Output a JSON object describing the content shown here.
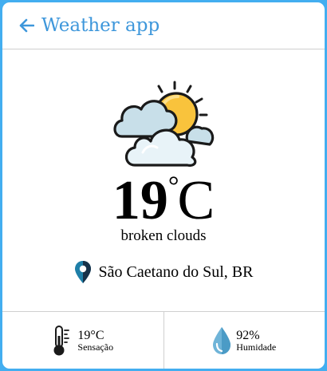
{
  "header": {
    "back_icon": "arrow-left-icon",
    "title": "Weather app"
  },
  "weather": {
    "icon": "broken-clouds-sun-icon",
    "temperature": "19",
    "degree_symbol": "°",
    "unit": "C",
    "description": "broken clouds"
  },
  "location": {
    "icon": "map-pin-icon",
    "text": "São Caetano do Sul, BR"
  },
  "details": {
    "feels_like": {
      "icon": "thermometer-icon",
      "value": "19°C",
      "label": "Sensação"
    },
    "humidity": {
      "icon": "water-drop-icon",
      "value": "92%",
      "label": "Humidade"
    }
  },
  "colors": {
    "background": "#43aef0",
    "accent": "#3e97db",
    "sun": "#f9c33c",
    "cloud": "#d2e7ef"
  }
}
